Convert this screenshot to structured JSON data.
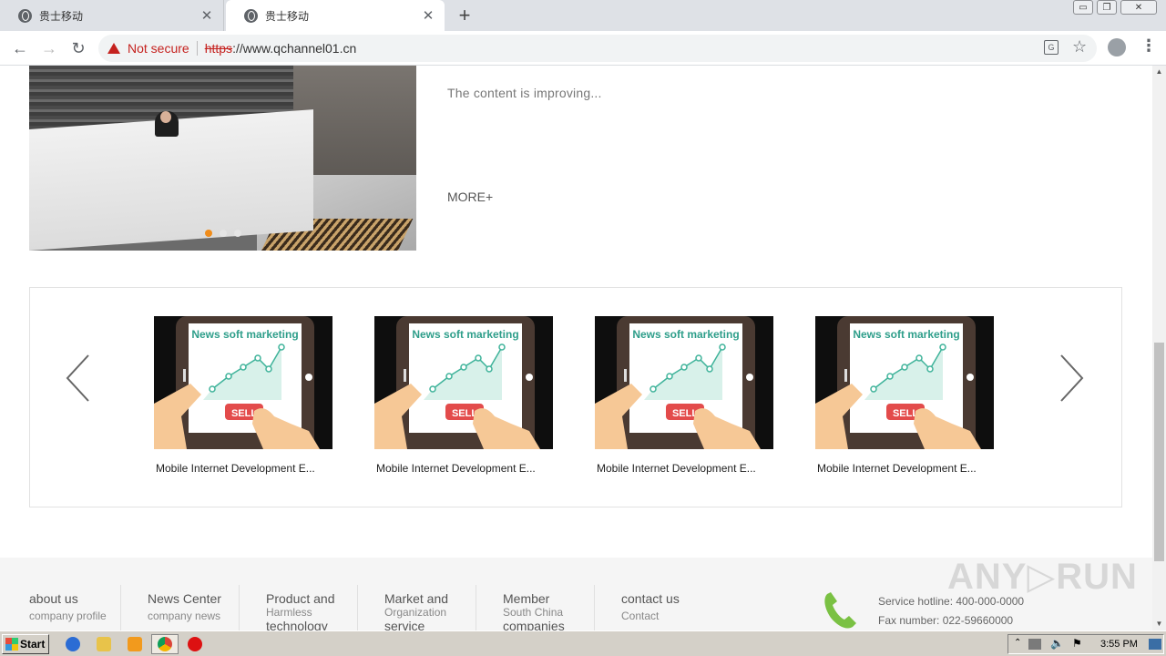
{
  "browser": {
    "tabs": [
      {
        "title": "贵士移动",
        "active": false
      },
      {
        "title": "贵士移动",
        "active": true
      }
    ],
    "new_tab": "+",
    "window_buttons": {
      "minimize": "▭",
      "restore": "❐",
      "close": "✕"
    },
    "security": {
      "label": "Not secure",
      "scheme": "https",
      "rest": "://www.qchannel01.cn"
    }
  },
  "intro": {
    "text": "The content is improving...",
    "more": "MORE+"
  },
  "carousel": {
    "thumb_banner": "News soft marketing",
    "thumb_button": "SELL",
    "items": [
      {
        "caption": "Mobile Internet Development E..."
      },
      {
        "caption": "Mobile Internet Development E..."
      },
      {
        "caption": "Mobile Internet Development E..."
      },
      {
        "caption": "Mobile Internet Development E..."
      }
    ]
  },
  "footer": {
    "columns": [
      {
        "title": "about us",
        "sub": "company profile"
      },
      {
        "title": "News Center",
        "sub": "company news"
      },
      {
        "title": "Product and technology",
        "sub": "Harmless"
      },
      {
        "title": "Market and service",
        "sub": "Organization"
      },
      {
        "title": "Member companies",
        "sub": "South China"
      },
      {
        "title": "contact us",
        "sub": "Contact"
      }
    ],
    "hotline": "Service hotline: 400-000-0000",
    "fax": "Fax number: 022-59660000"
  },
  "watermark": "ANY▷RUN",
  "taskbar": {
    "start": "Start",
    "clock": "3:55 PM"
  },
  "colors": {
    "accent_dot": "#f08c1a",
    "not_secure": "#c5221f",
    "phone_green": "#7ac143"
  }
}
